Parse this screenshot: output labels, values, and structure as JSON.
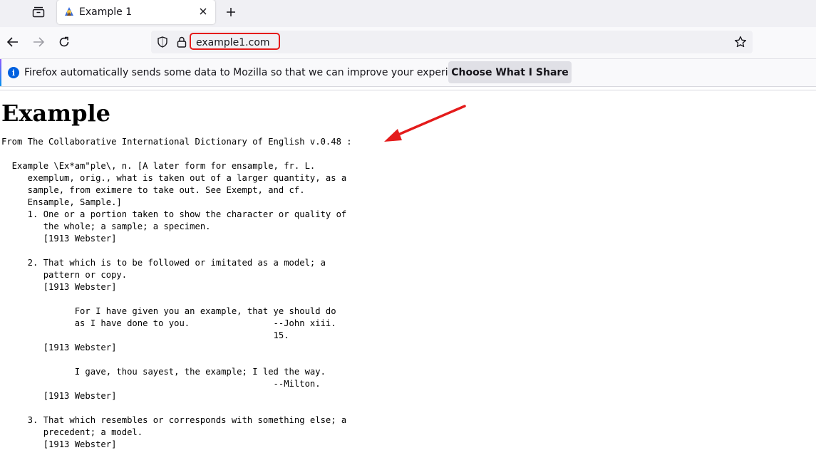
{
  "tab": {
    "title": "Example 1"
  },
  "urlbar": {
    "url": "example1.com"
  },
  "notification": {
    "text": "Firefox automatically sends some data to Mozilla so that we can improve your experience.",
    "button_label": "Choose What I Share"
  },
  "page": {
    "heading": "Example",
    "definition": "From The Collaborative International Dictionary of English v.0.48 :\n\n  Example \\Ex*am\"ple\\, n. [A later form for ensample, fr. L.\n     exemplum, orig., what is taken out of a larger quantity, as a\n     sample, from eximere to take out. See Exempt, and cf.\n     Ensample, Sample.]\n     1. One or a portion taken to show the character or quality of\n        the whole; a sample; a specimen.\n        [1913 Webster]\n\n     2. That which is to be followed or imitated as a model; a\n        pattern or copy.\n        [1913 Webster]\n\n              For I have given you an example, that ye should do\n              as I have done to you.                --John xiii.\n                                                    15.\n        [1913 Webster]\n\n              I gave, thou sayest, the example; I led the way.\n                                                    --Milton.\n        [1913 Webster]\n\n     3. That which resembles or corresponds with something else; a\n        precedent; a model.\n        [1913 Webster]"
  },
  "colors": {
    "highlight": "#e41b1b",
    "info": "#0060df",
    "tabstrip": "#f0f0f4"
  },
  "icons": {
    "tab_manager": "tab-manager-icon",
    "favicon": "favicon-icon",
    "close": "close-icon",
    "new_tab": "plus-icon",
    "back": "back-arrow-icon",
    "forward": "forward-arrow-icon",
    "reload": "reload-icon",
    "shield": "shield-icon",
    "lock": "lock-icon",
    "bookmark": "star-icon",
    "info": "info-icon",
    "annotation": "red-arrow-icon"
  }
}
